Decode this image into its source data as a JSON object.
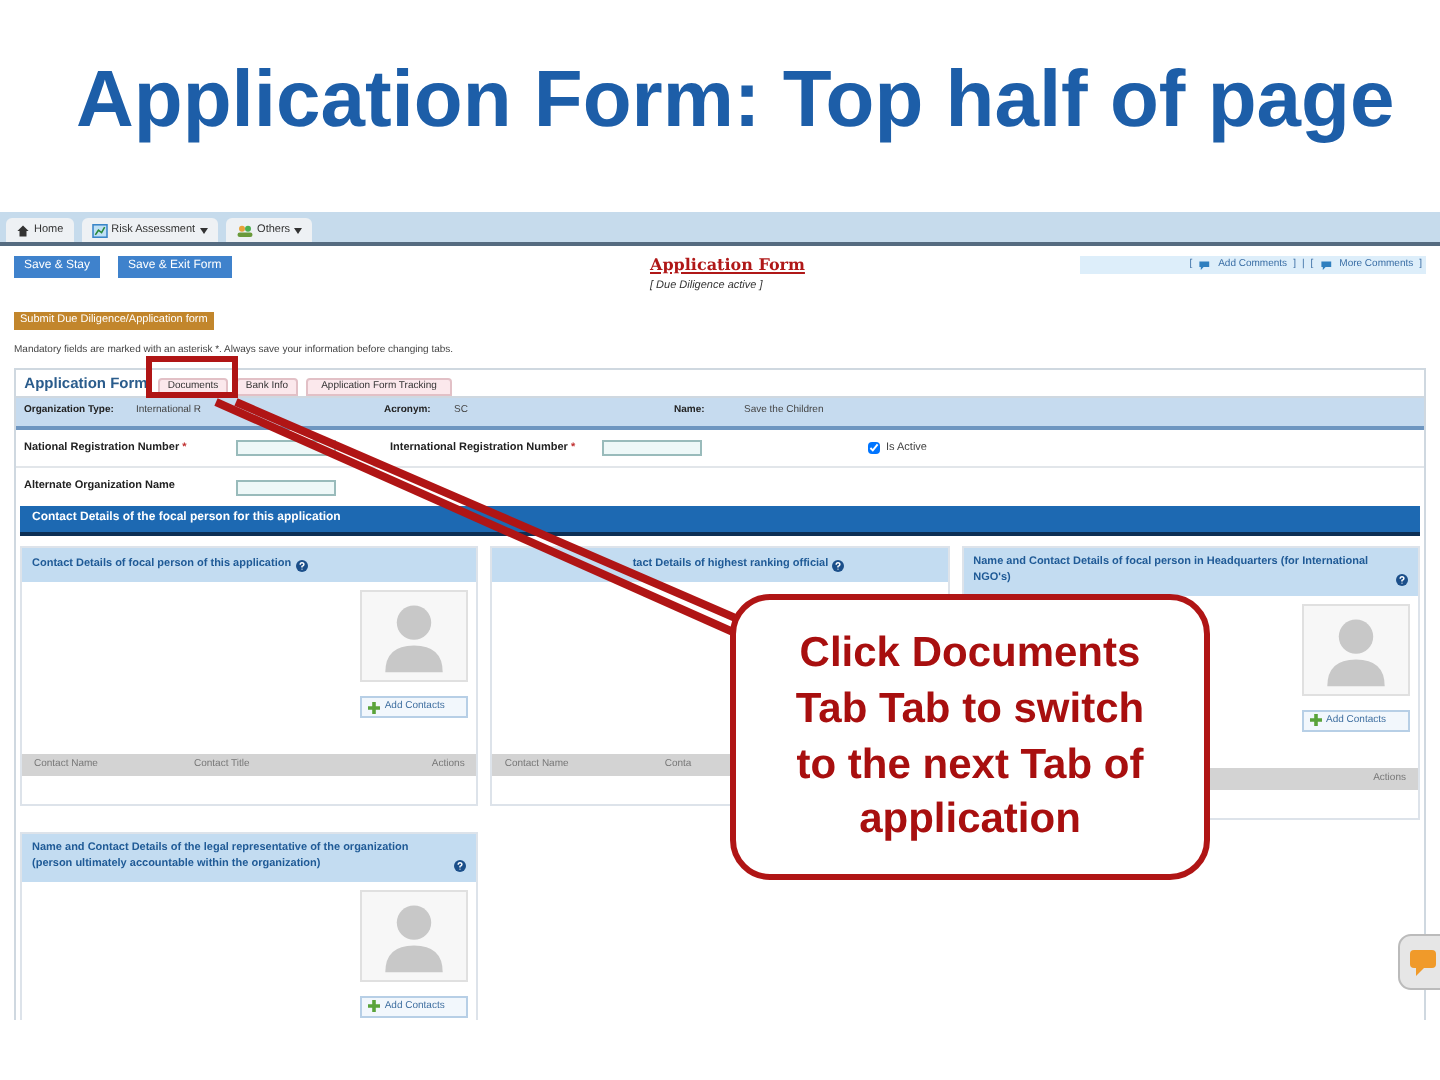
{
  "slide_title": "Application Form: Top half of page",
  "nav_tabs": [
    {
      "label": "Home",
      "dropdown": false
    },
    {
      "label": "Risk Assessment",
      "dropdown": true
    },
    {
      "label": "Others",
      "dropdown": true
    }
  ],
  "toolbar_buttons": [
    "Save & Stay",
    "Save & Exit Form"
  ],
  "form_title": "Application Form",
  "bracket_open": "[",
  "bracket_close": "]",
  "separator": "|",
  "comment_links": [
    "Add Comments",
    "More Comments"
  ],
  "status_note": "[ Due Diligence active ]",
  "submit_button": "Submit Due Diligence/Application form",
  "mandatory_note": "Mandatory fields are marked with an asterisk *. Always save your information before changing tabs.",
  "form_tabs": [
    {
      "label": "Application Form",
      "selected": true
    },
    {
      "label": "Documents",
      "selected": false
    },
    {
      "label": "Bank Info",
      "selected": false
    },
    {
      "label": "Application Form Tracking",
      "selected": false
    }
  ],
  "org_row": [
    {
      "label": "Organization Type:",
      "value": "International R"
    },
    {
      "label": "Acronym:",
      "value": "SC"
    },
    {
      "label": "Name:",
      "value": "Save the Children"
    }
  ],
  "reg_fields": [
    {
      "label": "National Registration Number",
      "mark": "*"
    },
    {
      "label": "International Registration Number",
      "mark": "*"
    }
  ],
  "is_active": {
    "label": "Is Active",
    "checked": true
  },
  "alt_field": {
    "label": "Alternate Organization Name"
  },
  "section_title": "Contact Details of the focal person for this application",
  "panels": [
    {
      "title": "Contact Details of focal person of this application",
      "add_button": "Add Contacts",
      "columns": [
        "Contact Name",
        "Contact Title",
        "Actions"
      ]
    },
    {
      "title": "tact Details of highest ranking official",
      "columns": [
        "Contact Name",
        "Conta"
      ]
    },
    {
      "title": "Name and Contact Details of focal person in Headquarters (for International NGO's)",
      "add_button": "Add Contacts",
      "columns": [
        "Actions"
      ]
    },
    {
      "title": "Name and Contact Details of the legal representative of the organization (person ultimately accountable within the organization)",
      "add_button": "Add Contacts"
    }
  ],
  "callout": "Click Documents Tab Tab to switch to the next Tab of application"
}
